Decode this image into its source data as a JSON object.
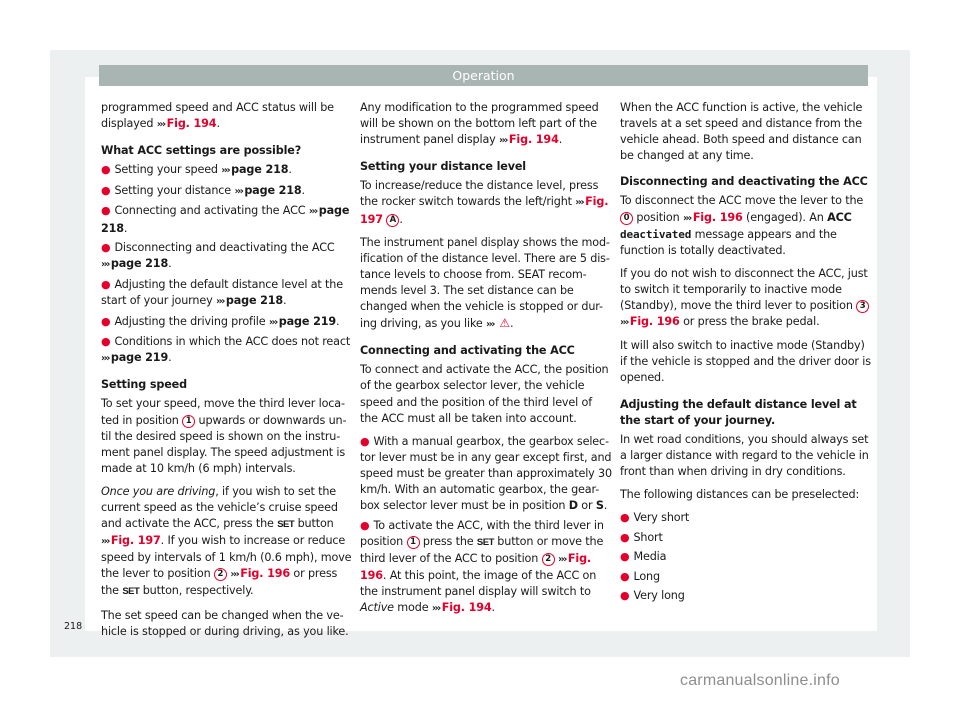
{
  "header": {
    "title": "Operation"
  },
  "page_number": "218",
  "watermark": "carmanualsonline.info",
  "colors": {
    "accent": "#e4002b",
    "header_bar": "#a8b5b3",
    "frame": "#edf0f1"
  },
  "symbols": {
    "arrow": "›››",
    "bullet": "●",
    "set_button": "SET",
    "warning": "⚠"
  },
  "col1": {
    "intro_a": "programmed speed and ACC status will be displayed ",
    "intro_ref": "Fig. 194",
    "intro_b": ".",
    "heading_settings": "What ACC settings are possible?",
    "settings": [
      {
        "text": "Setting your speed ",
        "ref": "page 218",
        "end": "."
      },
      {
        "text": "Setting your distance ",
        "ref": "page 218",
        "end": "."
      },
      {
        "text": "Connecting and activating the ACC ",
        "ref": "page 218",
        "end": "."
      },
      {
        "text": "Disconnecting and deactivating the ACC ",
        "ref": "page 218",
        "end": "."
      },
      {
        "text": "Adjusting the default distance level at the start of your journey ",
        "ref": "page 218",
        "end": "."
      },
      {
        "text": "Adjusting the driving profile ",
        "ref": "page 219",
        "end": "."
      },
      {
        "text": "Conditions in which the ACC does not react ",
        "ref": "page 219",
        "end": "."
      }
    ],
    "heading_speed": "Setting speed",
    "speed_p1_a": "To set your speed, move the third lever loca-ted in position ",
    "speed_p1_pos": "1",
    "speed_p1_b": " upwards or downwards un-til the desired speed is shown on the instru-ment panel display. The speed adjustment is made at 10 km/h (6 mph) intervals.",
    "speed_p2_italic": "Once you are driving",
    "speed_p2_a": ", if you wish to set the current speed as the vehicle’s cruise speed and activate the ACC, press the ",
    "speed_p2_b": " button ",
    "speed_p2_ref1": "Fig. 197",
    "speed_p2_c": ". If you wish to increase or reduce speed by intervals of 1 km/h (0.6 mph), move the lever to position ",
    "speed_p2_pos": "2",
    "speed_p2_ref2": "Fig. 196",
    "speed_p2_d": " or press the ",
    "speed_p2_e": " button, respectively.",
    "speed_p3": "The set speed can be changed when the ve-hicle is stopped or during driving, as you like."
  },
  "col2": {
    "intro_a": "Any modification to the programmed speed will be shown on the bottom left part of the instrument panel display ",
    "intro_ref": "Fig. 194",
    "intro_b": ".",
    "heading_distance": "Setting your distance level",
    "dist_p1_a": "To increase/reduce the distance level, press the rocker switch towards the left/right ",
    "dist_p1_ref": "Fig. 197",
    "dist_p1_pos": "A",
    "dist_p1_b": ".",
    "dist_p2_a": "The instrument panel display shows the mod-ification of the distance level. There are 5 dis-tance levels to choose from. SEAT recom-mends level 3. The set distance can be changed when the vehicle is stopped or dur-ing driving, as you like ",
    "dist_p2_b": ".",
    "heading_connect": "Connecting and activating the ACC",
    "conn_p1": "To connect and activate the ACC, the position of the gearbox selector lever, the vehicle speed and the position of the third level of the ACC must all be taken into account.",
    "conn_b1_a": "With a manual gearbox, the gearbox selec-tor lever must be in any gear except first, and speed must be greater than approximately 30 km/h. With an automatic gearbox, the gear-box selector lever must be in position ",
    "conn_b1_d": "D",
    "conn_b1_or": " or ",
    "conn_b1_s": "S",
    "conn_b1_end": ".",
    "conn_b2_a": "To activate the ACC, with the third lever in position ",
    "conn_b2_pos1": "1",
    "conn_b2_b": " press the ",
    "conn_b2_c": " button or move the third lever of the ACC to position ",
    "conn_b2_pos2": "2",
    "conn_b2_ref1": "Fig. 196",
    "conn_b2_d": ". At this point, the image of the ACC on the instrument panel display will switch to ",
    "conn_b2_italic": "Active",
    "conn_b2_e": " mode ",
    "conn_b2_ref2": "Fig. 194",
    "conn_b2_end": "."
  },
  "col3": {
    "intro": "When the ACC function is active, the vehicle travels at a set speed and distance from the vehicle ahead. Both speed and distance can be changed at any time.",
    "heading_disconnect": "Disconnecting and deactivating the ACC",
    "disc_p1_a": "To disconnect the ACC move the lever to the ",
    "disc_p1_pos": "0",
    "disc_p1_b": " position ",
    "disc_p1_ref": "Fig. 196",
    "disc_p1_c": " (engaged). An ",
    "disc_p1_acc": "ACC",
    "disc_p1_mono": "deactivated",
    "disc_p1_d": " message appears and the function is totally deactivated.",
    "disc_p2_a": "If you do not wish to disconnect the ACC, just to switch it temporarily to inactive mode (Standby), move the third lever to position ",
    "disc_p2_pos": "3",
    "disc_p2_ref": "Fig. 196",
    "disc_p2_b": " or press the brake pedal.",
    "disc_p3": "It will also switch to inactive mode (Standby) if the vehicle is stopped and the driver door is opened.",
    "heading_default": "Adjusting the default distance level at the start of your journey.",
    "def_p1": "In wet road conditions, you should always set a larger distance with regard to the vehicle in front than when driving in dry conditions.",
    "def_p2": "The following distances can be preselected:",
    "distances": [
      "Very short",
      "Short",
      "Media",
      "Long",
      "Very long"
    ]
  }
}
